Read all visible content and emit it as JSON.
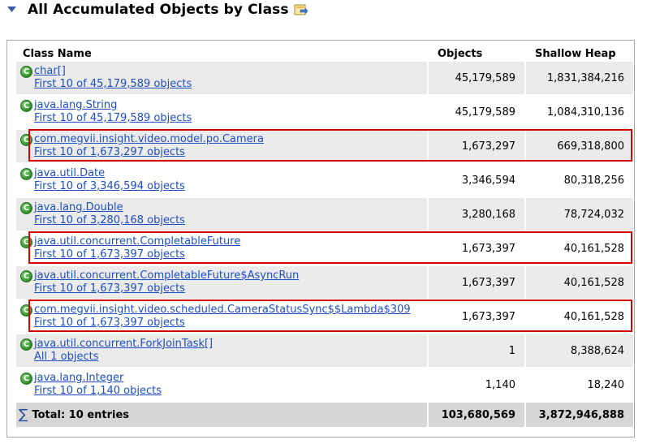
{
  "header": {
    "title": "All Accumulated Objects by Class"
  },
  "columns": {
    "class_name": "Class Name",
    "objects": "Objects",
    "shallow_heap": "Shallow Heap"
  },
  "rows": [
    {
      "class": "char[]",
      "sub": "First 10 of 45,179,589 objects",
      "objects": "45,179,589",
      "heap": "1,831,384,216",
      "highlighted": false
    },
    {
      "class": "java.lang.String",
      "sub": "First 10 of 45,179,589 objects",
      "objects": "45,179,589",
      "heap": "1,084,310,136",
      "highlighted": false
    },
    {
      "class": "com.megvii.insight.video.model.po.Camera",
      "sub": "First 10 of 1,673,297 objects",
      "objects": "1,673,297",
      "heap": "669,318,800",
      "highlighted": true
    },
    {
      "class": "java.util.Date",
      "sub": "First 10 of 3,346,594 objects",
      "objects": "3,346,594",
      "heap": "80,318,256",
      "highlighted": false
    },
    {
      "class": "java.lang.Double",
      "sub": "First 10 of 3,280,168 objects",
      "objects": "3,280,168",
      "heap": "78,724,032",
      "highlighted": false
    },
    {
      "class": "java.util.concurrent.CompletableFuture",
      "sub": "First 10 of 1,673,397 objects",
      "objects": "1,673,397",
      "heap": "40,161,528",
      "highlighted": true
    },
    {
      "class": "java.util.concurrent.CompletableFuture$AsyncRun",
      "sub": "First 10 of 1,673,397 objects",
      "objects": "1,673,397",
      "heap": "40,161,528",
      "highlighted": false
    },
    {
      "class": "com.megvii.insight.video.scheduled.CameraStatusSync$$Lambda$309",
      "sub": "First 10 of 1,673,397 objects",
      "objects": "1,673,397",
      "heap": "40,161,528",
      "highlighted": true
    },
    {
      "class": "java.util.concurrent.ForkJoinTask[]",
      "sub": "All 1 objects",
      "objects": "1",
      "heap": "8,388,624",
      "highlighted": false
    },
    {
      "class": "java.lang.Integer",
      "sub": "First 10 of 1,140 objects",
      "objects": "1,140",
      "heap": "18,240",
      "highlighted": false
    }
  ],
  "total": {
    "label": "Total: 10 entries",
    "objects": "103,680,569",
    "heap": "3,872,946,888"
  },
  "colors": {
    "link": "#1d4fc4",
    "highlight_border": "#d40000",
    "row_alt": "#ebebeb",
    "total_bg": "#d6d6d6"
  },
  "icons": {
    "collapse": "triangle-down-icon",
    "export": "export-icon",
    "class": "class-c-icon",
    "total": "sigma-icon"
  }
}
